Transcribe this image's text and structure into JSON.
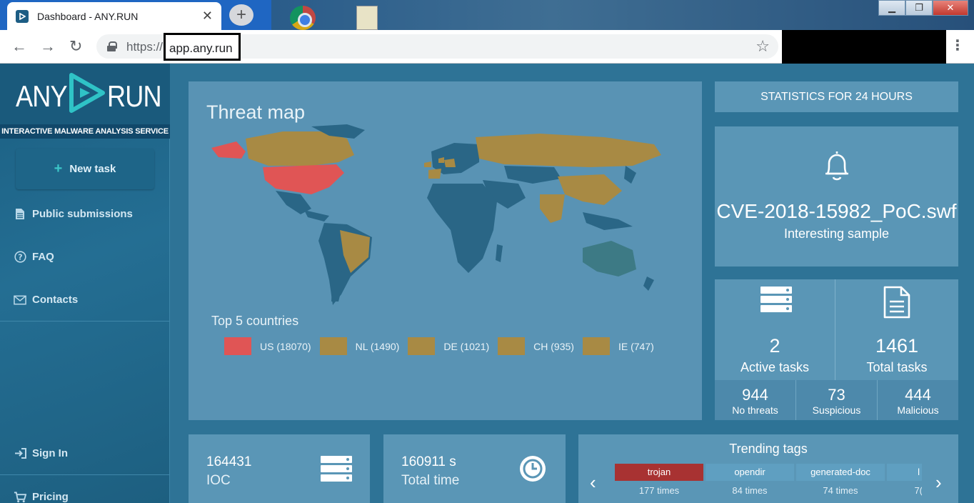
{
  "browser": {
    "tab_title": "Dashboard - ANY.RUN",
    "url_scheme": "https://",
    "url_host": "app.any.run"
  },
  "sidebar": {
    "logo_left": "ANY",
    "logo_right": "RUN",
    "tagline": "INTERACTIVE MALWARE ANALYSIS SERVICE",
    "new_task": "New task",
    "items": [
      {
        "label": "Public submissions",
        "icon": "file-icon"
      },
      {
        "label": "FAQ",
        "icon": "question-icon"
      },
      {
        "label": "Contacts",
        "icon": "envelope-icon"
      },
      {
        "label": "Sign In",
        "icon": "sign-in-icon"
      },
      {
        "label": "Pricing",
        "icon": "cart-icon"
      }
    ]
  },
  "threat_map": {
    "title": "Threat map",
    "top5_title": "Top 5 countries",
    "top5": [
      {
        "label": "US (18070)",
        "color": "#e05555"
      },
      {
        "label": "NL (1490)",
        "color": "#a88a44"
      },
      {
        "label": "DE (1021)",
        "color": "#a88a44"
      },
      {
        "label": "CH (935)",
        "color": "#a88a44"
      },
      {
        "label": "IE (747)",
        "color": "#a88a44"
      }
    ]
  },
  "stats": {
    "header": "STATISTICS FOR 24 HOURS",
    "sample_name": "CVE-2018-15982_PoC.swf",
    "sample_label": "Interesting sample",
    "active_tasks": "2",
    "active_tasks_label": "Active tasks",
    "total_tasks": "1461",
    "total_tasks_label": "Total tasks",
    "verdicts": [
      {
        "value": "944",
        "label": "No threats"
      },
      {
        "value": "73",
        "label": "Suspicious"
      },
      {
        "value": "444",
        "label": "Malicious"
      }
    ]
  },
  "bottom": {
    "ioc_value": "164431",
    "ioc_label": "IOC",
    "time_value": "160911 s",
    "time_label": "Total time",
    "trending_title": "Trending tags",
    "tags": [
      {
        "name": "trojan",
        "count": "177 times"
      },
      {
        "name": "opendir",
        "count": "84 times"
      },
      {
        "name": "generated-doc",
        "count": "74 times"
      },
      {
        "name": "l",
        "count": "7("
      }
    ]
  }
}
